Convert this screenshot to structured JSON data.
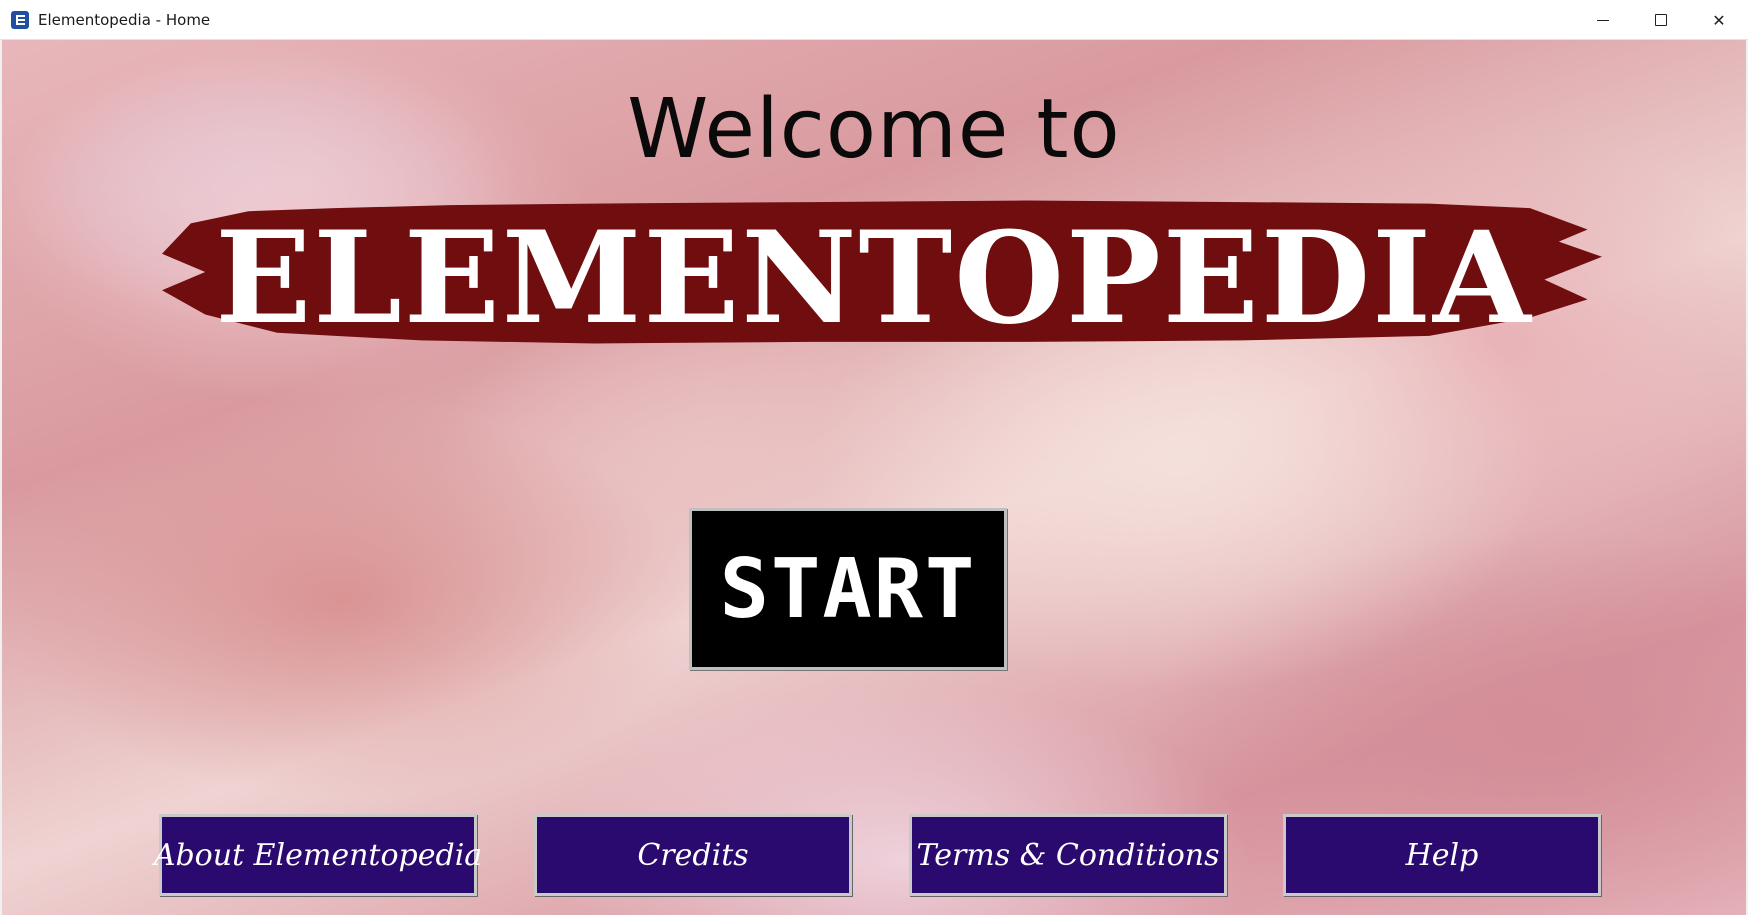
{
  "window": {
    "title": "Elementopedia - Home",
    "app_icon": "elementopedia-e-icon",
    "controls": [
      "minimize-icon",
      "maximize-icon",
      "close-icon"
    ],
    "close_glyph": "✕"
  },
  "hero": {
    "welcome": "Welcome to",
    "brand": "ELEMENTOPEDIA",
    "brand_banner_color": "#6f0d0f"
  },
  "actions": {
    "start_label": "START"
  },
  "nav": {
    "about": "About Elementopedia",
    "credits": "Credits",
    "terms": "Terms & Conditions",
    "help": "Help",
    "button_color": "#2a0a6e"
  }
}
